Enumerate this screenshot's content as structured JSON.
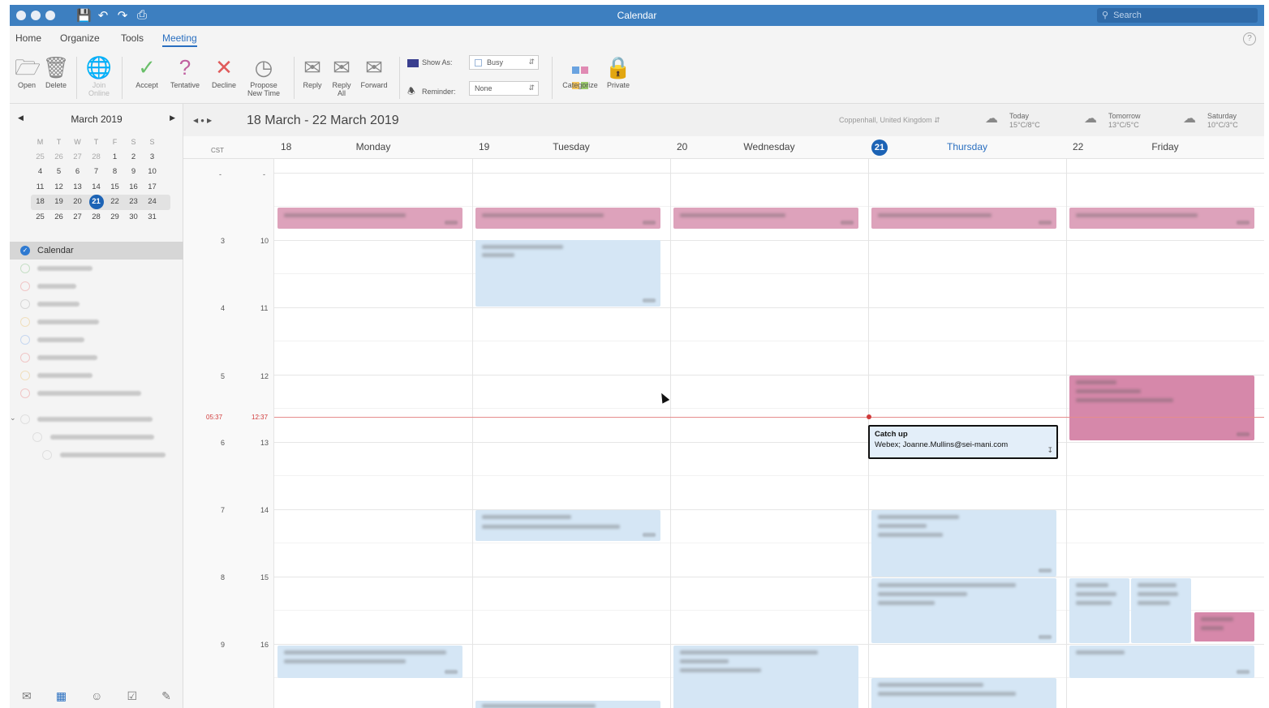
{
  "window": {
    "title": "Calendar",
    "search_placeholder": "Search"
  },
  "ribbon_tabs": [
    "Home",
    "Organize",
    "Tools",
    "Meeting"
  ],
  "ribbon": {
    "open": "Open",
    "delete": "Delete",
    "join_online": "Join Online",
    "accept": "Accept",
    "tentative": "Tentative",
    "decline": "Decline",
    "propose_new_time": "Propose New Time",
    "reply": "Reply",
    "reply_all": "Reply All",
    "forward": "Forward",
    "show_as_label": "Show As:",
    "show_as_value": "Busy",
    "reminder_label": "Reminder:",
    "reminder_value": "None",
    "categorize": "Categorize",
    "private": "Private"
  },
  "mini_calendar": {
    "month": "March 2019",
    "weekdays": [
      "M",
      "T",
      "W",
      "T",
      "F",
      "S",
      "S"
    ],
    "weeks": [
      [
        "25",
        "26",
        "27",
        "28",
        "1",
        "2",
        "3"
      ],
      [
        "4",
        "5",
        "6",
        "7",
        "8",
        "9",
        "10"
      ],
      [
        "11",
        "12",
        "13",
        "14",
        "15",
        "16",
        "17"
      ],
      [
        "18",
        "19",
        "20",
        "21",
        "22",
        "23",
        "24"
      ],
      [
        "25",
        "26",
        "27",
        "28",
        "29",
        "30",
        "31"
      ]
    ],
    "today": "21"
  },
  "calendars": {
    "selected": "Calendar"
  },
  "header": {
    "range": "18 March - 22 March 2019",
    "location": "Coppenhall, United Kingdom",
    "weather": [
      {
        "label": "Today",
        "temps": "15°C/8°C"
      },
      {
        "label": "Tomorrow",
        "temps": "13°C/5°C"
      },
      {
        "label": "Saturday",
        "temps": "10°C/3°C"
      }
    ]
  },
  "days": [
    {
      "num": "18",
      "name": "Monday"
    },
    {
      "num": "19",
      "name": "Tuesday"
    },
    {
      "num": "20",
      "name": "Wednesday"
    },
    {
      "num": "21",
      "name": "Thursday"
    },
    {
      "num": "22",
      "name": "Friday"
    }
  ],
  "timezone_label": "CST",
  "hours_left": [
    "-",
    "3",
    "4",
    "5",
    "6",
    "7",
    "8",
    "9"
  ],
  "hours_right": [
    "-",
    "10",
    "11",
    "12",
    "13",
    "14",
    "15",
    "16"
  ],
  "now_left": "05:37",
  "now_right": "12:37",
  "focused_event": {
    "title": "Catch up",
    "detail": "Webex; Joanne.Mullins@sei-mani.com"
  },
  "colors": {
    "titlebar": "#3d7fc0",
    "accent": "#2a6fc0",
    "pink_event": "#dda2bb",
    "blue_event": "#d5e6f5",
    "now_line": "#d03b3b"
  }
}
